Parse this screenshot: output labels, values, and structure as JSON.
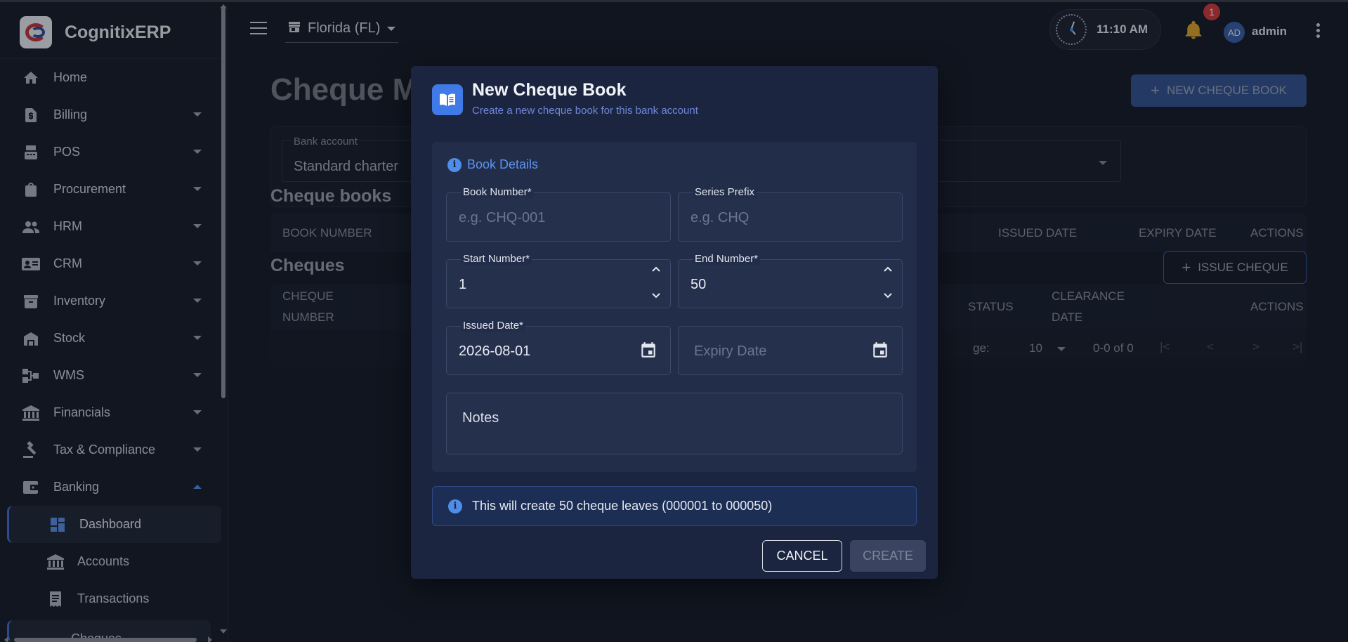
{
  "app": {
    "name": "CognitixERP"
  },
  "sidebar": {
    "items": [
      {
        "label": "Home",
        "icon": "home-icon"
      },
      {
        "label": "Billing",
        "icon": "billing-icon"
      },
      {
        "label": "POS",
        "icon": "pos-icon"
      },
      {
        "label": "Procurement",
        "icon": "procurement-icon"
      },
      {
        "label": "HRM",
        "icon": "people-icon"
      },
      {
        "label": "CRM",
        "icon": "contact-card-icon"
      },
      {
        "label": "Inventory",
        "icon": "inventory-icon"
      },
      {
        "label": "Stock",
        "icon": "warehouse-icon"
      },
      {
        "label": "WMS",
        "icon": "wms-icon"
      },
      {
        "label": "Financials",
        "icon": "bank-icon"
      },
      {
        "label": "Tax & Compliance",
        "icon": "gavel-icon"
      },
      {
        "label": "Banking",
        "icon": "wallet-icon"
      }
    ],
    "banking_sub": [
      {
        "label": "Dashboard",
        "icon": "dashboard-icon"
      },
      {
        "label": "Accounts",
        "icon": "bank-icon"
      },
      {
        "label": "Transactions",
        "icon": "receipt-icon"
      }
    ],
    "partial_item": "Cheques"
  },
  "topbar": {
    "location": "Florida (FL)",
    "time": "11:10 AM",
    "notification_count": "1",
    "avatar_initials": "AD",
    "user": "admin"
  },
  "page": {
    "title": "Cheque M",
    "new_book_button": "NEW CHEQUE BOOK",
    "bank_account_label": "Bank account",
    "bank_account_value": "Standard charter",
    "cheque_books_title": "Cheque books",
    "cheque_books_columns": [
      "BOOK NUMBER",
      "ISSUED DATE",
      "EXPIRY DATE",
      "ACTIONS"
    ],
    "cheques_title": "Cheques",
    "issue_cheque_button": "ISSUE CHEQUE",
    "cheques_columns": {
      "cheque_number_1": "CHEQUE",
      "cheque_number_2": "NUMBER",
      "status": "STATUS",
      "clearance_1": "CLEARANCE",
      "clearance_2": "DATE",
      "actions": "ACTIONS"
    },
    "rows_per_page_label": "ge:",
    "rows_per_page": "10",
    "pagination_range": "0-0 of 0"
  },
  "dialog": {
    "title": "New Cheque Book",
    "subtitle": "Create a new cheque book for this bank account",
    "section_title": "Book Details",
    "book_number": {
      "label": "Book Number*",
      "placeholder": "e.g. CHQ-001",
      "value": ""
    },
    "series_prefix": {
      "label": "Series Prefix",
      "placeholder": "e.g. CHQ",
      "value": ""
    },
    "start_number": {
      "label": "Start Number*",
      "value": "1"
    },
    "end_number": {
      "label": "End Number*",
      "value": "50"
    },
    "issued_date": {
      "label": "Issued Date*",
      "value": "2026-08-01"
    },
    "expiry_date": {
      "placeholder": "Expiry Date"
    },
    "notes": {
      "placeholder": "Notes"
    },
    "info_text": "This will create 50 cheque leaves (000001 to 000050)",
    "cancel_label": "CANCEL",
    "create_label": "CREATE"
  },
  "colors": {
    "accent": "#3f7ae6",
    "background": "#151b27",
    "dialog": "#1c2540",
    "badge": "#d13b3b",
    "bell": "#e0a52a"
  }
}
